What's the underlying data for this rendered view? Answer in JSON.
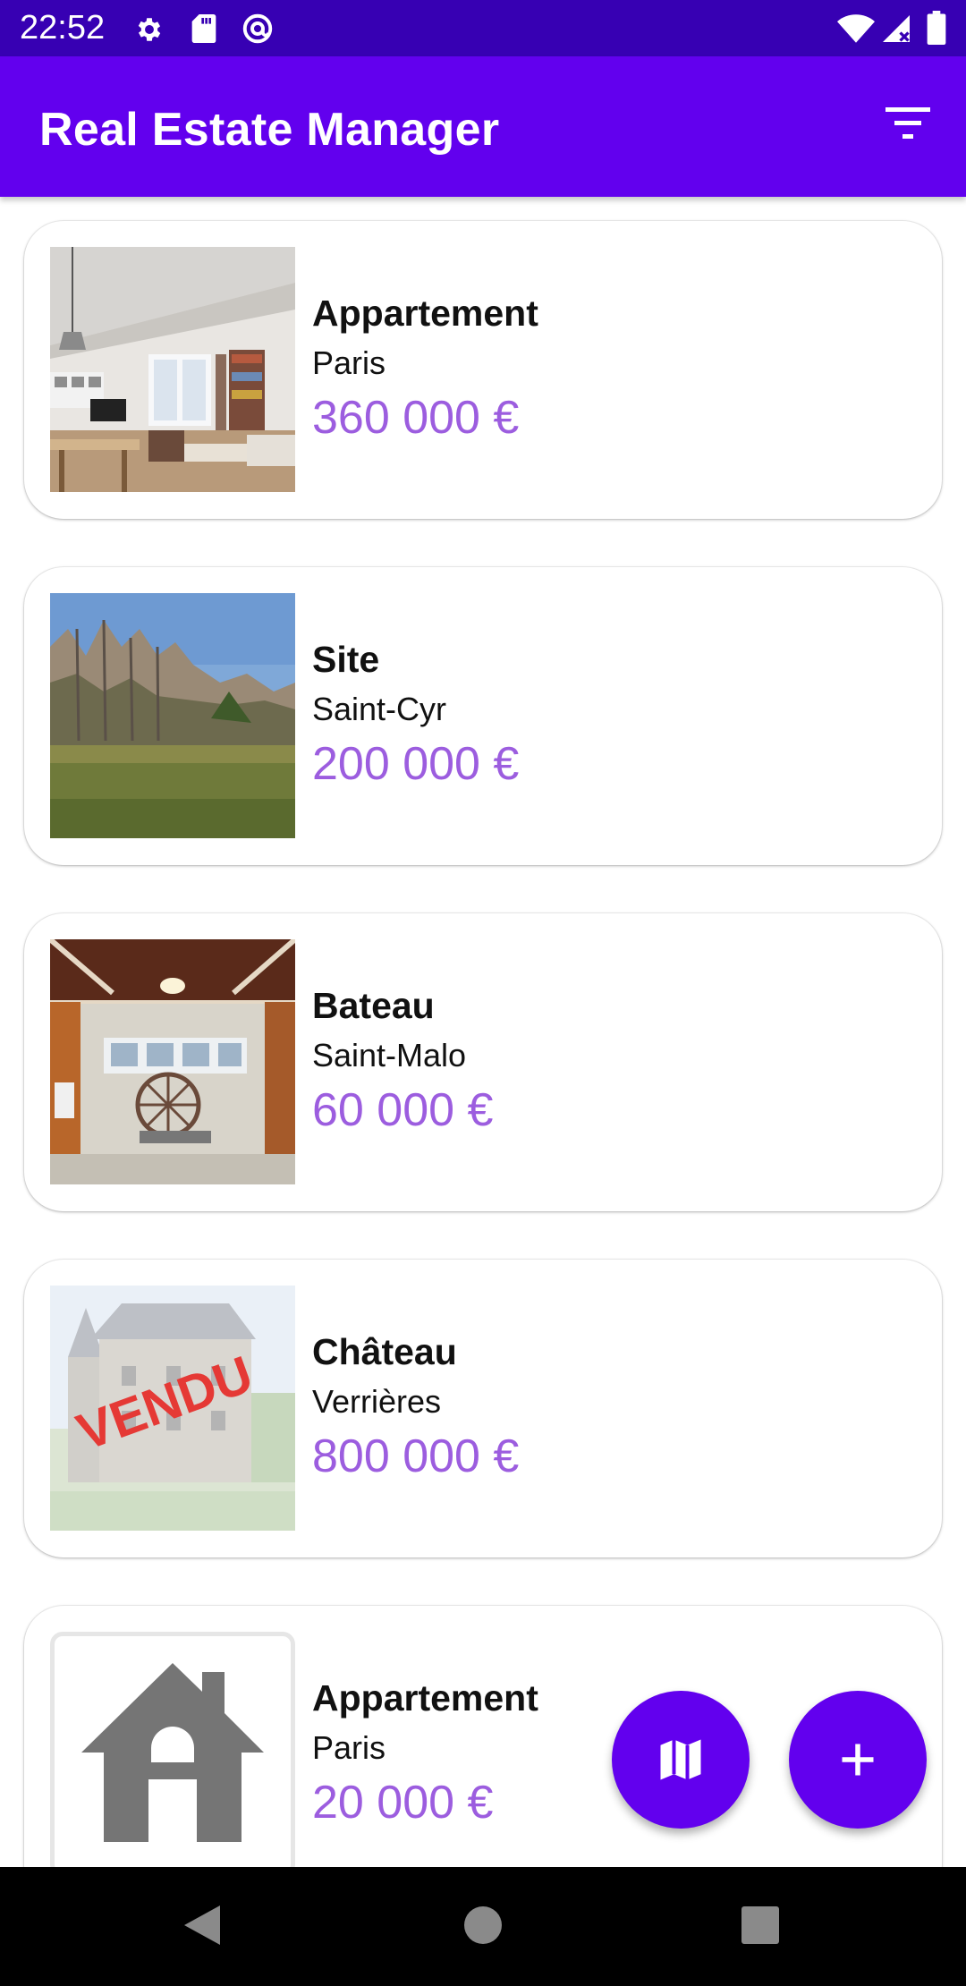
{
  "status_bar": {
    "time": "22:52",
    "icons": [
      "settings-icon",
      "sd-card-icon",
      "vpn-icon",
      "wifi-icon",
      "signal-icon",
      "battery-icon"
    ]
  },
  "app_bar": {
    "title": "Real Estate Manager",
    "action_icon": "filter-icon"
  },
  "colors": {
    "primary": "#6200ee",
    "primary_dark": "#3700b3",
    "price": "#9c5ddf",
    "vendu_stamp": "#e53935"
  },
  "listings": [
    {
      "type": "Appartement",
      "city": "Paris",
      "price": "360 000 €",
      "photo": "apartment-interior"
    },
    {
      "type": "Site",
      "city": "Saint-Cyr",
      "price": "200 000 €",
      "photo": "field-with-trees"
    },
    {
      "type": "Bateau",
      "city": "Saint-Malo",
      "price": "60 000 €",
      "photo": "boat-cabin"
    },
    {
      "type": "Château",
      "city": "Verrières",
      "price": "800 000 €",
      "photo": "castle",
      "stamp": "VENDU"
    },
    {
      "type": "Appartement",
      "city": "Paris",
      "price": "20 000 €",
      "photo": "house-placeholder-icon"
    }
  ],
  "fabs": [
    "map-icon",
    "add-icon"
  ],
  "nav": [
    "back-icon",
    "home-icon",
    "recents-icon"
  ]
}
